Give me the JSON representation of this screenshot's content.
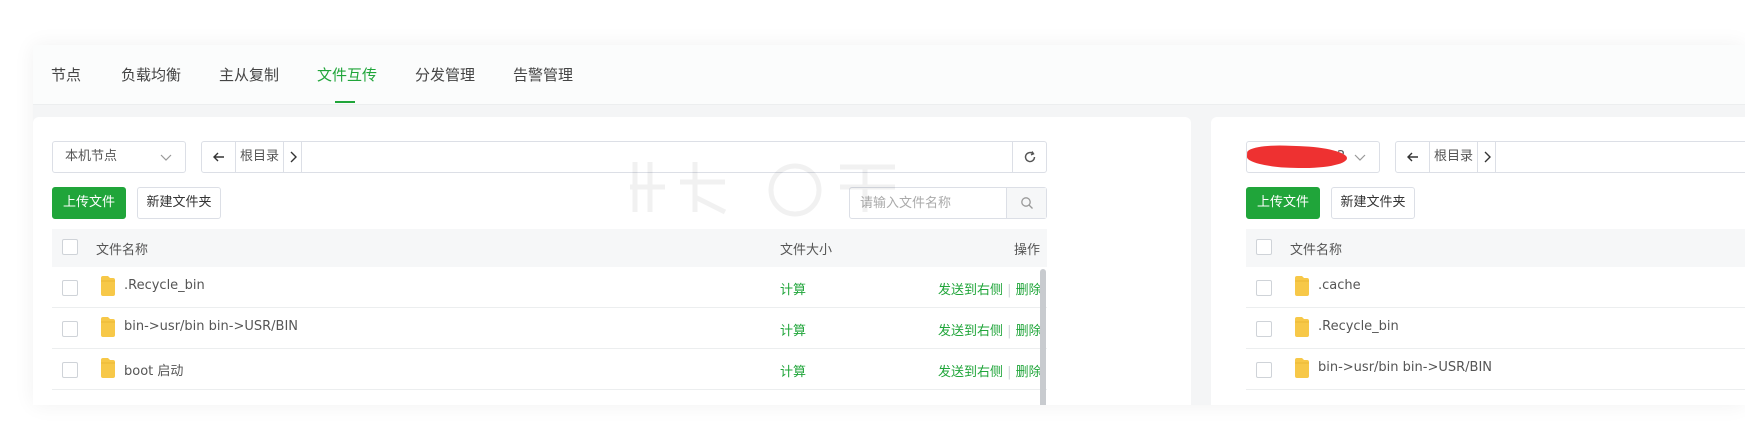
{
  "tabs": [
    {
      "label": "节点"
    },
    {
      "label": "负载均衡"
    },
    {
      "label": "主从复制"
    },
    {
      "label": "文件互传",
      "active": true
    },
    {
      "label": "分发管理"
    },
    {
      "label": "告警管理"
    }
  ],
  "colors": {
    "accent": "#20a53a",
    "folder": "#f7c848",
    "redaction": "#ee3131"
  },
  "left_panel": {
    "node_select": "本机节点",
    "path": {
      "back_icon": "arrow-left-icon",
      "root_label": "根目录",
      "next_icon": "chevron-right-icon",
      "refresh_icon": "refresh-icon"
    },
    "upload_label": "上传文件",
    "new_folder_label": "新建文件夹",
    "search_placeholder": "请输入文件名称",
    "columns": {
      "name": "文件名称",
      "size": "文件大小",
      "actions": "操作"
    },
    "rows": [
      {
        "name": ".Recycle_bin",
        "size_action": "计算",
        "send_action": "发送到右侧",
        "delete_action": "删除"
      },
      {
        "name": "bin->usr/bin bin->USR/BIN",
        "size_action": "计算",
        "send_action": "发送到右侧",
        "delete_action": "删除"
      },
      {
        "name": "boot 启动",
        "size_action": "计算",
        "send_action": "发送到右侧",
        "delete_action": "删除"
      }
    ]
  },
  "right_panel": {
    "node_select": "2",
    "path": {
      "root_label": "根目录"
    },
    "upload_label": "上传文件",
    "new_folder_label": "新建文件夹",
    "columns": {
      "name": "文件名称"
    },
    "rows": [
      {
        "name": ".cache"
      },
      {
        "name": ".Recycle_bin"
      },
      {
        "name": "bin->usr/bin bin->USR/BIN"
      }
    ]
  }
}
